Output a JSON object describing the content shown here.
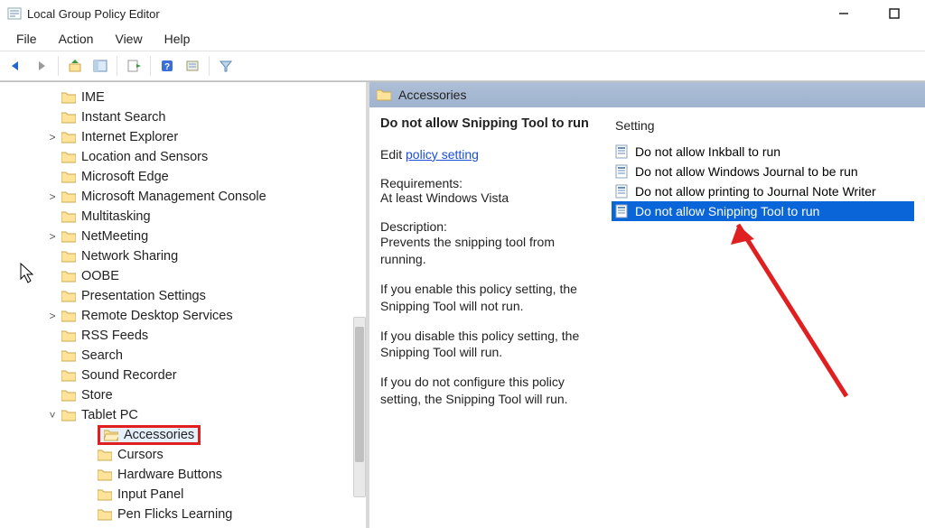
{
  "window": {
    "title": "Local Group Policy Editor"
  },
  "menu": {
    "file": "File",
    "action": "Action",
    "view": "View",
    "help": "Help"
  },
  "tree": {
    "items": [
      {
        "label": "IME",
        "expand": ""
      },
      {
        "label": "Instant Search",
        "expand": ""
      },
      {
        "label": "Internet Explorer",
        "expand": ">"
      },
      {
        "label": "Location and Sensors",
        "expand": ""
      },
      {
        "label": "Microsoft Edge",
        "expand": ""
      },
      {
        "label": "Microsoft Management Console",
        "expand": ">"
      },
      {
        "label": "Multitasking",
        "expand": ""
      },
      {
        "label": "NetMeeting",
        "expand": ">"
      },
      {
        "label": "Network Sharing",
        "expand": ""
      },
      {
        "label": "OOBE",
        "expand": ""
      },
      {
        "label": "Presentation Settings",
        "expand": ""
      },
      {
        "label": "Remote Desktop Services",
        "expand": ">"
      },
      {
        "label": "RSS Feeds",
        "expand": ""
      },
      {
        "label": "Search",
        "expand": ""
      },
      {
        "label": "Sound Recorder",
        "expand": ""
      },
      {
        "label": "Store",
        "expand": ""
      },
      {
        "label": "Tablet PC",
        "expand": "v"
      }
    ],
    "subitems": [
      {
        "label": "Accessories",
        "selected": true
      },
      {
        "label": "Cursors"
      },
      {
        "label": "Hardware Buttons"
      },
      {
        "label": "Input Panel"
      },
      {
        "label": "Pen Flicks Learning"
      }
    ]
  },
  "detail": {
    "header": "Accessories",
    "policy_title": "Do not allow Snipping Tool to run",
    "edit_prefix": "Edit ",
    "edit_link": "policy setting ",
    "req_label": "Requirements:",
    "req_value": "At least Windows Vista",
    "desc_label": "Description:",
    "desc_p1": "Prevents the snipping tool from running.",
    "desc_p2": "If you enable this policy setting, the Snipping Tool will not run.",
    "desc_p3": "If you disable this policy setting, the Snipping Tool will run.",
    "desc_p4": "If you do not configure this policy setting, the Snipping Tool will run.",
    "col_header": "Setting",
    "settings": [
      {
        "label": "Do not allow Inkball to run",
        "selected": false
      },
      {
        "label": "Do not allow Windows Journal to be run",
        "selected": false
      },
      {
        "label": "Do not allow printing to Journal Note Writer",
        "selected": false
      },
      {
        "label": "Do not allow Snipping Tool to run",
        "selected": true
      }
    ]
  },
  "chart_data": null
}
